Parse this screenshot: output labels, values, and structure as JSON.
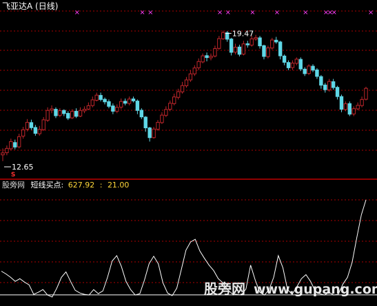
{
  "header": {
    "title": "飞亚达A",
    "period": "(日线)",
    "title_color": "#ffffff"
  },
  "price_panel": {
    "high_label": "19.47",
    "low_label": "12.65",
    "marker_symbol": "×",
    "marker_color": "#ff40ff",
    "signal_label": "S",
    "signal_color": "#ff3030",
    "grid_color": "#b00000",
    "up_color": "#c0262b",
    "down_color": "#5fd7e6"
  },
  "indicator_panel": {
    "source": "股旁网",
    "name": "短线买点:",
    "value": "627.92",
    "ref_value": "21.00",
    "separator": ":",
    "line_color": "#ffffff",
    "ref_line_color": "#ffffff"
  },
  "watermark": {
    "cn": "股旁网",
    "url": "www.gupang.com"
  },
  "chart_data": {
    "type": "candlestick",
    "price_range": [
      12.3,
      20.4
    ],
    "high": 19.47,
    "low": 12.65,
    "marker_candles": [
      18,
      34,
      36,
      53,
      55,
      61,
      67,
      74,
      79,
      80,
      81,
      90
    ],
    "candles": [
      [
        13.12,
        13.22,
        12.8,
        13.45
      ],
      [
        13.23,
        13.45,
        13.1,
        13.6
      ],
      [
        13.43,
        13.8,
        13.35,
        13.95
      ],
      [
        13.75,
        13.52,
        13.4,
        13.9
      ],
      [
        13.53,
        14.05,
        13.45,
        14.2
      ],
      [
        14.08,
        14.4,
        13.95,
        14.55
      ],
      [
        14.43,
        14.78,
        14.32,
        14.95
      ],
      [
        14.77,
        14.51,
        14.4,
        14.92
      ],
      [
        14.52,
        14.22,
        14.1,
        14.65
      ],
      [
        14.2,
        14.42,
        14.1,
        14.6
      ],
      [
        14.41,
        14.91,
        14.35,
        15.05
      ],
      [
        14.89,
        15.39,
        14.8,
        15.55
      ],
      [
        15.4,
        15.47,
        15.25,
        15.65
      ],
      [
        15.45,
        15.12,
        15.0,
        15.55
      ],
      [
        15.14,
        15.38,
        15.05,
        15.5
      ],
      [
        15.39,
        15.23,
        15.1,
        15.45
      ],
      [
        15.24,
        15.0,
        14.9,
        15.35
      ],
      [
        15.01,
        15.34,
        14.95,
        15.45
      ],
      [
        15.35,
        15.09,
        15.0,
        15.5
      ],
      [
        15.1,
        15.39,
        15.05,
        15.55
      ],
      [
        15.37,
        15.45,
        15.25,
        15.6
      ],
      [
        15.46,
        15.63,
        15.4,
        15.8
      ],
      [
        15.64,
        15.93,
        15.55,
        16.1
      ],
      [
        15.91,
        16.17,
        15.85,
        16.3
      ],
      [
        16.16,
        15.95,
        15.85,
        16.3
      ],
      [
        15.96,
        15.83,
        15.7,
        16.05
      ],
      [
        15.84,
        15.6,
        15.5,
        15.95
      ],
      [
        15.62,
        15.35,
        15.2,
        15.75
      ],
      [
        15.35,
        15.55,
        15.25,
        15.7
      ],
      [
        15.56,
        15.85,
        15.45,
        16.0
      ],
      [
        15.86,
        15.76,
        15.65,
        16.0
      ],
      [
        15.75,
        15.97,
        15.65,
        16.1
      ],
      [
        15.98,
        15.88,
        15.8,
        16.1
      ],
      [
        15.87,
        15.39,
        15.2,
        15.95
      ],
      [
        15.4,
        15.06,
        14.95,
        15.5
      ],
      [
        15.05,
        14.5,
        14.3,
        15.1
      ],
      [
        14.5,
        14.0,
        13.8,
        14.55
      ],
      [
        14.0,
        14.44,
        13.95,
        14.55
      ],
      [
        14.43,
        14.78,
        14.35,
        14.9
      ],
      [
        14.77,
        15.15,
        14.7,
        15.3
      ],
      [
        15.14,
        15.44,
        15.05,
        15.6
      ],
      [
        15.45,
        15.76,
        15.35,
        15.9
      ],
      [
        15.74,
        16.08,
        15.65,
        16.25
      ],
      [
        16.06,
        16.35,
        15.95,
        16.5
      ],
      [
        16.34,
        16.66,
        16.25,
        16.85
      ],
      [
        16.65,
        16.95,
        16.55,
        17.1
      ],
      [
        16.95,
        17.26,
        16.85,
        17.45
      ],
      [
        17.26,
        17.56,
        17.15,
        17.7
      ],
      [
        17.57,
        17.89,
        17.45,
        18.05
      ],
      [
        17.87,
        18.18,
        17.8,
        18.3
      ],
      [
        18.19,
        18.09,
        17.9,
        18.35
      ],
      [
        18.08,
        18.16,
        17.95,
        18.3
      ],
      [
        18.17,
        18.55,
        18.1,
        18.7
      ],
      [
        18.56,
        19.06,
        18.5,
        19.2
      ],
      [
        19.05,
        19.37,
        19.0,
        19.47
      ],
      [
        19.36,
        19.03,
        18.9,
        19.45
      ],
      [
        19.04,
        18.36,
        18.2,
        19.1
      ],
      [
        18.37,
        18.62,
        18.25,
        18.8
      ],
      [
        18.63,
        18.26,
        18.15,
        18.75
      ],
      [
        18.27,
        18.79,
        18.2,
        18.95
      ],
      [
        18.8,
        18.74,
        18.6,
        18.95
      ],
      [
        18.73,
        19.05,
        18.65,
        19.2
      ],
      [
        19.04,
        19.11,
        18.95,
        19.25
      ],
      [
        19.1,
        18.69,
        18.55,
        19.2
      ],
      [
        18.7,
        18.15,
        18.0,
        18.75
      ],
      [
        18.14,
        18.59,
        18.05,
        18.7
      ],
      [
        18.58,
        18.99,
        18.5,
        19.1
      ],
      [
        18.98,
        18.89,
        18.8,
        19.15
      ],
      [
        18.89,
        18.18,
        18.0,
        18.95
      ],
      [
        18.17,
        17.85,
        17.7,
        18.25
      ],
      [
        17.84,
        17.57,
        17.45,
        17.95
      ],
      [
        17.58,
        17.81,
        17.45,
        17.95
      ],
      [
        17.8,
        18.01,
        17.7,
        18.1
      ],
      [
        18.0,
        17.51,
        17.4,
        18.1
      ],
      [
        17.5,
        17.27,
        17.15,
        17.6
      ],
      [
        17.28,
        17.66,
        17.2,
        17.75
      ],
      [
        17.65,
        17.45,
        17.35,
        17.75
      ],
      [
        17.46,
        17.13,
        17.0,
        17.55
      ],
      [
        17.12,
        16.68,
        16.5,
        17.2
      ],
      [
        16.69,
        16.45,
        16.3,
        16.8
      ],
      [
        16.44,
        16.87,
        16.35,
        17.0
      ],
      [
        16.86,
        16.56,
        16.45,
        17.0
      ],
      [
        16.57,
        16.1,
        15.95,
        16.65
      ],
      [
        16.1,
        15.45,
        15.3,
        16.2
      ],
      [
        15.44,
        15.73,
        15.35,
        15.85
      ],
      [
        15.74,
        15.2,
        15.1,
        15.85
      ],
      [
        15.21,
        15.48,
        15.1,
        15.6
      ],
      [
        15.47,
        15.65,
        15.4,
        15.8
      ],
      [
        15.64,
        15.95,
        15.55,
        16.1
      ],
      [
        15.96,
        16.52,
        15.9,
        16.6
      ]
    ],
    "indicator_range": [
      0,
      720
    ],
    "indicator_values": [
      195,
      175,
      150,
      120,
      140,
      115,
      95,
      25,
      40,
      60,
      20,
      5,
      70,
      150,
      190,
      120,
      55,
      35,
      25,
      20,
      60,
      30,
      50,
      150,
      270,
      310,
      230,
      120,
      60,
      20,
      30,
      130,
      250,
      305,
      250,
      110,
      35,
      15,
      70,
      210,
      350,
      410,
      430,
      345,
      290,
      240,
      200,
      140,
      110,
      60,
      30,
      25,
      20,
      65,
      240,
      130,
      40,
      20,
      60,
      150,
      310,
      220,
      60,
      25,
      80,
      140,
      170,
      120,
      50,
      30,
      20,
      40,
      20,
      25,
      100,
      150,
      260,
      440,
      610,
      720
    ]
  }
}
